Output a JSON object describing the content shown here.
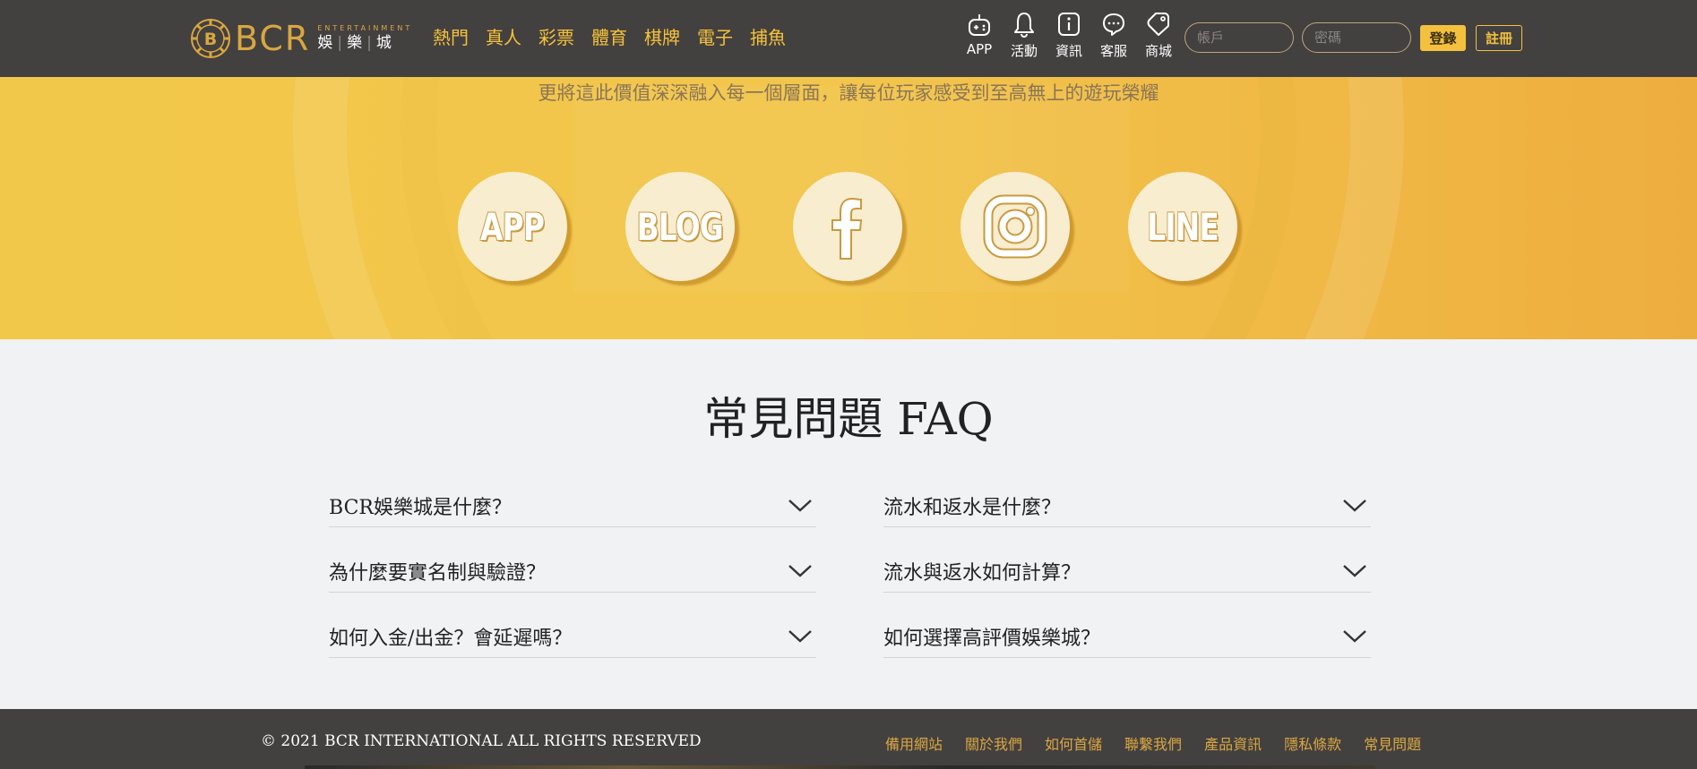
{
  "header": {
    "logo": {
      "brand": "BCR",
      "entertainment": "ENTERTAINMENT",
      "cn": [
        "娛",
        "樂",
        "城"
      ]
    },
    "nav": [
      "熱門",
      "真人",
      "彩票",
      "體育",
      "棋牌",
      "電子",
      "捕魚"
    ],
    "icon_nav": [
      {
        "icon": "gamepad-icon",
        "label": "APP"
      },
      {
        "icon": "bell-icon",
        "label": "活動"
      },
      {
        "icon": "info-icon",
        "label": "資訊"
      },
      {
        "icon": "chat-icon",
        "label": "客服"
      },
      {
        "icon": "tag-icon",
        "label": "商城"
      }
    ],
    "account_placeholder": "帳戶",
    "password_placeholder": "密碼",
    "login_label": "登錄",
    "register_label": "註冊"
  },
  "band": {
    "text": "更將這此價值深深融入每一個層面，讓每位玩家感受到至高無上的遊玩榮耀",
    "social": [
      {
        "id": "app",
        "label": "APP"
      },
      {
        "id": "blog",
        "label": "BLOG"
      },
      {
        "id": "facebook",
        "icon": "facebook-icon"
      },
      {
        "id": "instagram",
        "icon": "instagram-icon"
      },
      {
        "id": "line",
        "label": "LINE"
      }
    ]
  },
  "faq": {
    "title": "常見問題 FAQ",
    "left": [
      "BCR娛樂城是什麼？",
      "為什麼要實名制與驗證？",
      "如何入金/出金？會延遲嗎？"
    ],
    "right": [
      "流水和返水是什麼？",
      "流水與返水如何計算？",
      "如何選擇高評價娛樂城？"
    ]
  },
  "footer": {
    "copyright": "© 2021 BCR INTERNATIONAL ALL RIGHTS RESERVED",
    "links": [
      "備用網站",
      "關於我們",
      "如何首儲",
      "聯繫我們",
      "產品資訊",
      "隱私條款",
      "常見問題"
    ]
  },
  "colors": {
    "header_bg": "#434040",
    "accent_gold": "#f3c13e",
    "band_yellow": "#f2c84a",
    "page_bg": "#f1f2f4"
  }
}
